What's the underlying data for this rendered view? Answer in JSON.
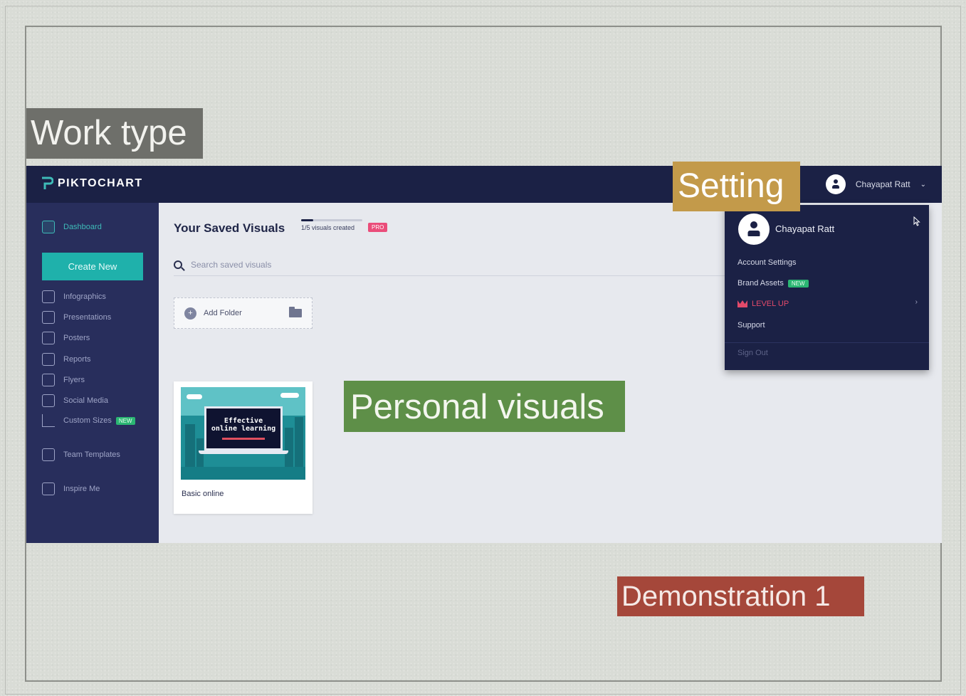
{
  "overlay_labels": {
    "work_type": "Work type",
    "setting": "Setting",
    "personal_visuals": "Personal visuals",
    "demonstration": "Demonstration 1"
  },
  "app": {
    "brand": "PIKTOCHART",
    "topbar_user": "Chayapat Ratt",
    "sidebar": {
      "dashboard": "Dashboard",
      "create_new": "Create New",
      "items": [
        "Infographics",
        "Presentations",
        "Posters",
        "Reports",
        "Flyers",
        "Social Media",
        "Custom Sizes"
      ],
      "new_badge": "NEW",
      "team_templates": "Team Templates",
      "inspire_me": "Inspire Me"
    },
    "main": {
      "title": "Your Saved Visuals",
      "quota_text": "1/5 visuals created",
      "quota_fraction": 0.2,
      "pro_badge": "PRO",
      "search_placeholder": "Search saved visuals",
      "add_folder": "Add Folder",
      "card_title": "Basic online",
      "thumb_text_line1": "Effective",
      "thumb_text_line2": "online learning"
    },
    "dropdown": {
      "name": "Chayapat Ratt",
      "account_settings": "Account Settings",
      "brand_assets": "Brand Assets",
      "new_badge": "NEW",
      "level_up": "LEVEL UP",
      "support": "Support",
      "sign_out": "Sign Out"
    }
  },
  "colors": {
    "topbar": "#1b2145",
    "sidebar": "#282e5c",
    "accent": "#1fb1ab",
    "label_work": "#6e6f6a",
    "label_setting": "#c39a4a",
    "label_personal": "#5e8f48",
    "label_demo": "#a5473a"
  }
}
